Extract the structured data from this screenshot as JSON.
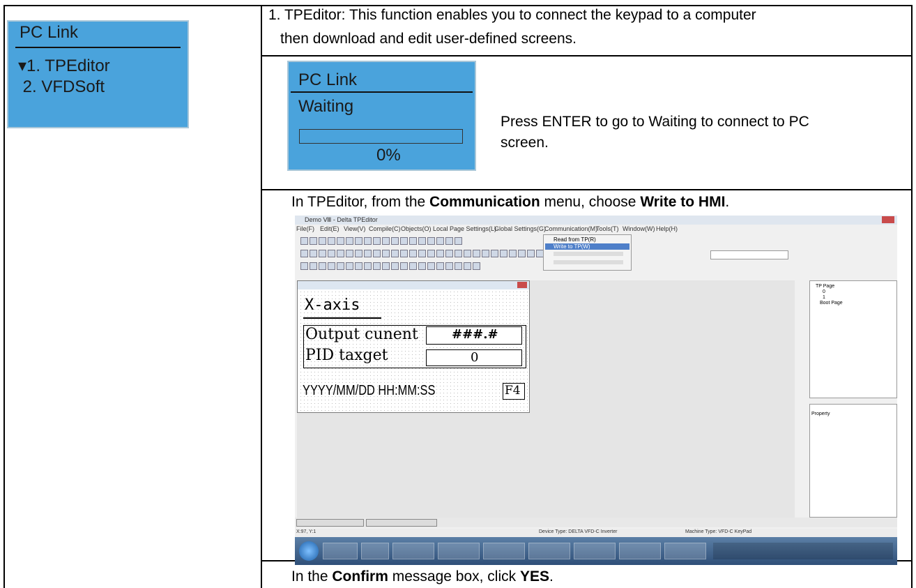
{
  "keypad_menu": {
    "title": "PC Link",
    "items": [
      "▾1. TPEditor",
      " 2. VFDSoft"
    ]
  },
  "step1": {
    "line1": "1. TPEditor: This function enables you to connect the keypad to a computer",
    "line2": "then download and edit user-defined screens."
  },
  "keypad_waiting": {
    "title": "PC Link",
    "status": "Waiting",
    "progress_label": "0%",
    "progress": 0
  },
  "press_enter": {
    "line1": "Press ENTER to go to Waiting to connect to PC",
    "line2": "screen."
  },
  "instruction_menu": {
    "prefix": "In TPEditor, from the ",
    "menu": "Communication",
    "middle": " menu, choose ",
    "choice": "Write to HMI",
    "suffix": "."
  },
  "editor": {
    "window_title": "Demo Ⅷ - Delta TPEditor",
    "menus": [
      "File(F)",
      "Edit(E)",
      "View(V)",
      "Compile(C)",
      "Objects(O)",
      "Local Page Settings(L)",
      "Global Settings(G)",
      "Communication(M)",
      "Tools(T)",
      "Window(W)",
      "Help(H)"
    ],
    "comm_items": [
      "Read from TP(R)",
      "Write to TP(W)"
    ],
    "screen": {
      "title": "X-axis",
      "row1_label": "Output cunent",
      "row1_value": "###.#",
      "row2_label": "PID taxget",
      "row2_value": "0",
      "datetime": "YYYY/MM/DD  HH:MM:SS",
      "fkey": "F4"
    },
    "tree": [
      "TP Page",
      "0",
      "1",
      "Boot Page"
    ],
    "property_label": "Property",
    "status_left": "X:97, Y:1",
    "status_device": "Device Type: DELTA VFD-C Inverter",
    "status_machine": "Machine Type: VFD-C KeyPad"
  },
  "instruction_confirm": {
    "prefix": "In the ",
    "box": "Confirm",
    "middle": " message box, click ",
    "button": "YES",
    "suffix": "."
  }
}
